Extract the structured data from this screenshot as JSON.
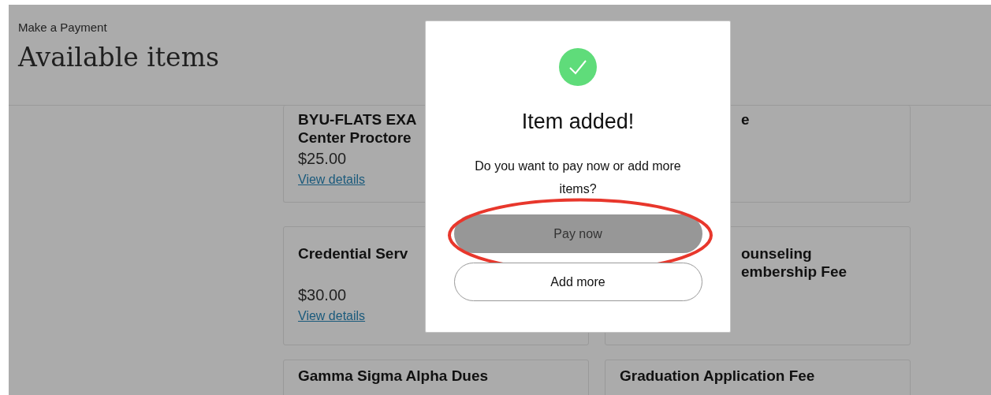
{
  "header": {
    "breadcrumb": "Make a Payment",
    "title": "Available items"
  },
  "cards": [
    {
      "title_lines": [
        "BYU-FLATS EXA",
        "Center Proctore"
      ],
      "price": "$25.00",
      "link": "View details"
    },
    {
      "title_lines": [
        "e"
      ]
    },
    {
      "title_lines": [
        "Credential Serv"
      ],
      "price": "$30.00",
      "link": "View details"
    },
    {
      "title_lines": [
        "ounseling",
        "embership Fee"
      ]
    },
    {
      "title_lines": [
        "Gamma Sigma Alpha Dues"
      ]
    },
    {
      "title_lines": [
        "Graduation Application Fee"
      ]
    }
  ],
  "modal": {
    "title": "Item added!",
    "message": "Do you want to pay now or add more items?",
    "buttons": [
      {
        "label": "Pay now",
        "kind": "primary",
        "highlighted": true
      },
      {
        "label": "Add more",
        "kind": "secondary",
        "highlighted": false
      }
    ]
  }
}
